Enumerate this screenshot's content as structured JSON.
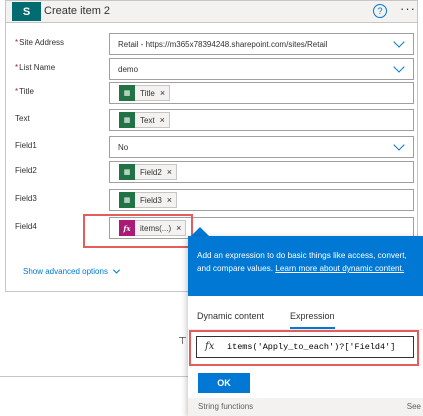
{
  "card": {
    "title": "Create item 2",
    "logo_letter": "S",
    "help_glyph": "?",
    "more_glyph": "···"
  },
  "fields": {
    "site_address": {
      "label": "Site Address",
      "value": "Retail - https://m365x78394248.sharepoint.com/sites/Retail"
    },
    "list_name": {
      "label": "List Name",
      "value": "demo"
    },
    "title": {
      "label": "Title",
      "token": "Title"
    },
    "text": {
      "label": "Text",
      "token": "Text"
    },
    "field1": {
      "label": "Field1",
      "value": "No"
    },
    "field2": {
      "label": "Field2",
      "token": "Field2"
    },
    "field3": {
      "label": "Field3",
      "token": "Field3"
    },
    "field4": {
      "label": "Field4",
      "token": "items(...)"
    }
  },
  "required_marker": "*",
  "token_remove": "×",
  "show_advanced": "Show advanced options",
  "popup": {
    "banner_text": "Add an expression to do basic things like access, convert, and compare values.",
    "banner_link": "Learn more about dynamic content.",
    "tabs": [
      "Dynamic content",
      "Expression"
    ],
    "active_tab": "Expression",
    "fx": "fx",
    "expression": "items('Apply_to_each')?['Field4']",
    "ok_label": "OK",
    "footer_left": "String functions",
    "footer_right": "See"
  },
  "colors": {
    "accent": "#0078d4",
    "excel_token": "#217346",
    "expression_token": "#aa1b78",
    "highlight": "#e35d5d",
    "sharepoint": "#036c70"
  },
  "icons": {
    "excel": "excel-table-icon",
    "fx": "function-icon",
    "chevron": "chevron-down-icon",
    "help": "help-icon",
    "more": "more-icon"
  }
}
